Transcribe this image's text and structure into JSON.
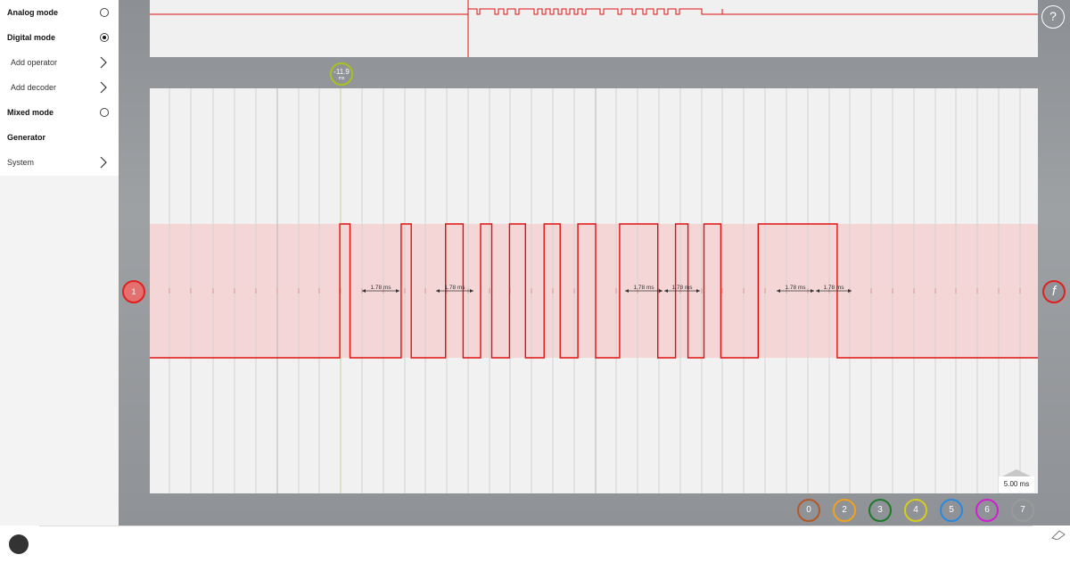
{
  "sidebar": {
    "items": [
      {
        "label": "Analog mode",
        "style": "bold",
        "control": "radio",
        "selected": false
      },
      {
        "label": "Digital mode",
        "style": "bold",
        "control": "radio",
        "selected": true
      },
      {
        "label": "Add operator",
        "style": "sub",
        "control": "chevron"
      },
      {
        "label": "Add decoder",
        "style": "sub",
        "control": "chevron"
      },
      {
        "label": "Mixed mode",
        "style": "bold",
        "control": "radio",
        "selected": false
      },
      {
        "label": "Generator",
        "style": "bold",
        "control": "none"
      },
      {
        "label": "System",
        "style": "plain",
        "control": "chevron"
      }
    ]
  },
  "help": {
    "label": "?"
  },
  "cursor": {
    "value": "-11.9",
    "unit": "ms",
    "color": "#a9c11d"
  },
  "channel_marker": {
    "label": "1",
    "color": "#e02020"
  },
  "trigger": {
    "label": "f"
  },
  "timebase": {
    "label": "5.00 ms"
  },
  "measurements": [
    {
      "label": "1.78 ms"
    },
    {
      "label": "1.78 ms"
    },
    {
      "label": "1.78 ms"
    },
    {
      "label": "1.78 ms"
    },
    {
      "label": "1.78 ms"
    },
    {
      "label": "1.78 ms"
    }
  ],
  "channels": [
    {
      "label": "0",
      "color": "#b15a28"
    },
    {
      "label": "2",
      "color": "#f0a21e"
    },
    {
      "label": "3",
      "color": "#1e7a2a"
    },
    {
      "label": "4",
      "color": "#d6cc1e"
    },
    {
      "label": "5",
      "color": "#2a88e0"
    },
    {
      "label": "6",
      "color": "#d21ed2"
    },
    {
      "label": "7",
      "color": "#9a9a9a"
    }
  ],
  "signal": {
    "color": "#e01010",
    "band_color": "#f4d6d6",
    "levels": [
      0,
      1,
      0,
      1,
      0,
      1,
      0,
      1,
      0,
      1,
      0,
      1,
      0,
      1,
      0,
      1,
      0,
      1,
      0,
      1,
      0,
      1,
      0
    ],
    "edges_ms": [
      0,
      21.4,
      22.54,
      28.3,
      29.44,
      33.3,
      35.28,
      37.25,
      38.5,
      40.5,
      42.3,
      44.4,
      46.2,
      48.2,
      50.2,
      52.9,
      57.2,
      59.2,
      60.6,
      62.4,
      64.3,
      68.5,
      77.4,
      100
    ]
  }
}
